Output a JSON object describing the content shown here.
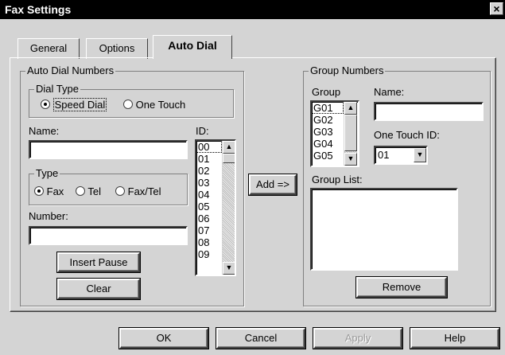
{
  "window": {
    "title": "Fax Settings",
    "close_glyph": "×"
  },
  "tabs": [
    {
      "label": "General",
      "active": false
    },
    {
      "label": "Options",
      "active": false
    },
    {
      "label": "Auto Dial",
      "active": true
    }
  ],
  "auto_dial": {
    "group_label": "Auto Dial Numbers",
    "dial_type": {
      "label": "Dial Type",
      "options": [
        {
          "label": "Speed Dial",
          "selected": true
        },
        {
          "label": "One Touch",
          "selected": false
        }
      ]
    },
    "name_label": "Name:",
    "name_value": "",
    "id_label": "ID:",
    "id_list": [
      "00",
      "01",
      "02",
      "03",
      "04",
      "05",
      "06",
      "07",
      "08",
      "09"
    ],
    "type": {
      "label": "Type",
      "options": [
        {
          "label": "Fax",
          "selected": true
        },
        {
          "label": "Tel",
          "selected": false
        },
        {
          "label": "Fax/Tel",
          "selected": false
        }
      ]
    },
    "number_label": "Number:",
    "number_value": "",
    "insert_pause_label": "Insert Pause",
    "clear_label": "Clear"
  },
  "add_button_label": "Add =>",
  "group_numbers": {
    "group_label": "Group Numbers",
    "group_col_label": "Group",
    "group_list": [
      "G01",
      "G02",
      "G03",
      "G04",
      "G05"
    ],
    "name_label": "Name:",
    "name_value": "",
    "one_touch_label": "One Touch ID:",
    "one_touch_value": "01",
    "group_list_label": "Group List:",
    "remove_label": "Remove"
  },
  "footer": {
    "ok_label": "OK",
    "cancel_label": "Cancel",
    "apply_label": "Apply",
    "help_label": "Help"
  }
}
